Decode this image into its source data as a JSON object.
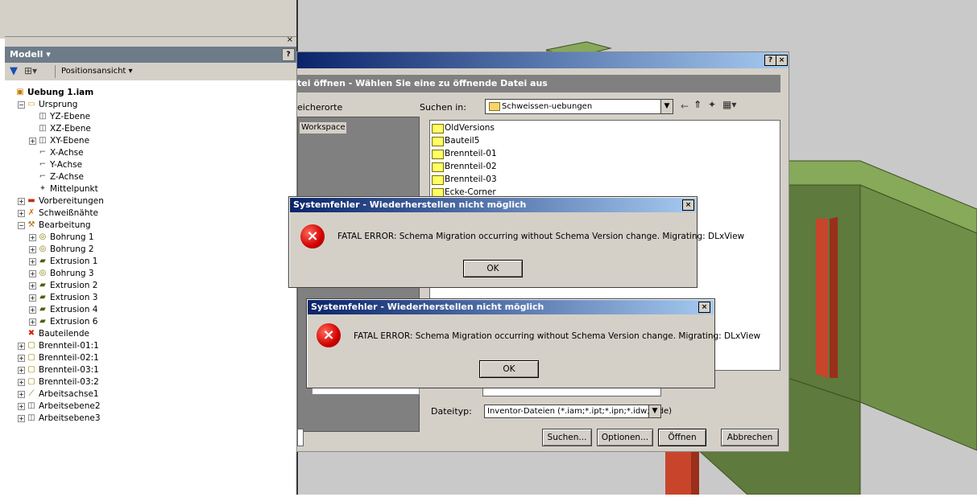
{
  "model_browser": {
    "header": "Modell ▾",
    "help": "?",
    "close": "×",
    "filter_icon": "filter-icon",
    "filter_dropdown": "▾",
    "view_label": "Positionsansicht  ▾",
    "tree": [
      {
        "label": "Uebung 1.iam",
        "level": 0,
        "icon": "assembly",
        "bold": true,
        "expander": ""
      },
      {
        "label": "Ursprung",
        "level": 1,
        "icon": "folder",
        "expander": "−"
      },
      {
        "label": "YZ-Ebene",
        "level": 2,
        "icon": "plane",
        "expander": ""
      },
      {
        "label": "XZ-Ebene",
        "level": 2,
        "icon": "plane",
        "expander": ""
      },
      {
        "label": "XY-Ebene",
        "level": 2,
        "icon": "plane",
        "expander": "+"
      },
      {
        "label": "X-Achse",
        "level": 2,
        "icon": "axis",
        "expander": ""
      },
      {
        "label": "Y-Achse",
        "level": 2,
        "icon": "axis",
        "expander": ""
      },
      {
        "label": "Z-Achse",
        "level": 2,
        "icon": "axis",
        "expander": ""
      },
      {
        "label": "Mittelpunkt",
        "level": 2,
        "icon": "point",
        "expander": ""
      },
      {
        "label": "Vorbereitungen",
        "level": 1,
        "icon": "prep",
        "expander": "+"
      },
      {
        "label": "Schweißnähte",
        "level": 1,
        "icon": "weld",
        "expander": "+"
      },
      {
        "label": "Bearbeitung",
        "level": 1,
        "icon": "machining",
        "expander": "−"
      },
      {
        "label": "Bohrung 1",
        "level": 2,
        "icon": "hole",
        "expander": "+"
      },
      {
        "label": "Bohrung 2",
        "level": 2,
        "icon": "hole",
        "expander": "+"
      },
      {
        "label": "Extrusion 1",
        "level": 2,
        "icon": "extrude",
        "expander": "+"
      },
      {
        "label": "Bohrung 3",
        "level": 2,
        "icon": "hole",
        "expander": "+"
      },
      {
        "label": "Extrusion 2",
        "level": 2,
        "icon": "extrude",
        "expander": "+"
      },
      {
        "label": "Extrusion 3",
        "level": 2,
        "icon": "extrude",
        "expander": "+"
      },
      {
        "label": "Extrusion 4",
        "level": 2,
        "icon": "extrude",
        "expander": "+"
      },
      {
        "label": "Extrusion 6",
        "level": 2,
        "icon": "extrude",
        "expander": "+"
      },
      {
        "label": "Bauteilende",
        "level": 1,
        "icon": "end",
        "expander": ""
      },
      {
        "label": "Brennteil-01:1",
        "level": 1,
        "icon": "part",
        "expander": "+"
      },
      {
        "label": "Brennteil-02:1",
        "level": 1,
        "icon": "part",
        "expander": "+"
      },
      {
        "label": "Brennteil-03:1",
        "level": 1,
        "icon": "part",
        "expander": "+"
      },
      {
        "label": "Brennteil-03:2",
        "level": 1,
        "icon": "part",
        "expander": "+"
      },
      {
        "label": "Arbeitsachse1",
        "level": 1,
        "icon": "workaxis",
        "expander": "+"
      },
      {
        "label": "Arbeitsebene2",
        "level": 1,
        "icon": "plane",
        "expander": "+"
      },
      {
        "label": "Arbeitsebene3",
        "level": 1,
        "icon": "plane",
        "expander": "+"
      }
    ]
  },
  "open_dialog": {
    "help": "?",
    "close": "×",
    "banner": "tei öffnen - Wählen Sie eine zu öffnende Datei aus",
    "places_label": "eicherorte",
    "workspace": "Workspace",
    "look_in_label": "Suchen in:",
    "look_in_value": "Schweissen-uebungen",
    "combo_arrow": "▼",
    "nav_back": "←",
    "nav_up": "⇑",
    "nav_new": "✦",
    "nav_view": "▦▾",
    "files": [
      "OldVersions",
      "Bauteil5",
      "Brennteil-01",
      "Brennteil-02",
      "Brennteil-03",
      "Ecke-Corner"
    ],
    "file_type_label": "Dateityp:",
    "file_type_value": "Inventor-Dateien (*.iam;*.ipt;*.ipn;*.idw;*.ide)",
    "buttons": {
      "search": "Suchen...",
      "options": "Optionen...",
      "open": "Öffnen",
      "cancel": "Abbrechen"
    }
  },
  "error_dialogs": [
    {
      "title": "Systemfehler - Wiederherstellen nicht möglich",
      "message": "FATAL ERROR: Schema Migration occurring without Schema Version change. Migrating: DLxView",
      "ok": "OK",
      "close": "×",
      "icon": "×"
    },
    {
      "title": "Systemfehler - Wiederherstellen nicht möglich",
      "message": "FATAL ERROR: Schema Migration occurring without Schema Version change. Migrating: DLxView",
      "ok": "OK",
      "close": "×",
      "icon": "×"
    }
  ],
  "colors": {
    "model_green": "#5e7a3c",
    "model_green_light": "#86a95a",
    "weld_red": "#c8452b",
    "viewport_bg": "#c9c9c9",
    "title_gradient_start": "#0a246a",
    "title_gradient_end": "#a6caf0"
  }
}
